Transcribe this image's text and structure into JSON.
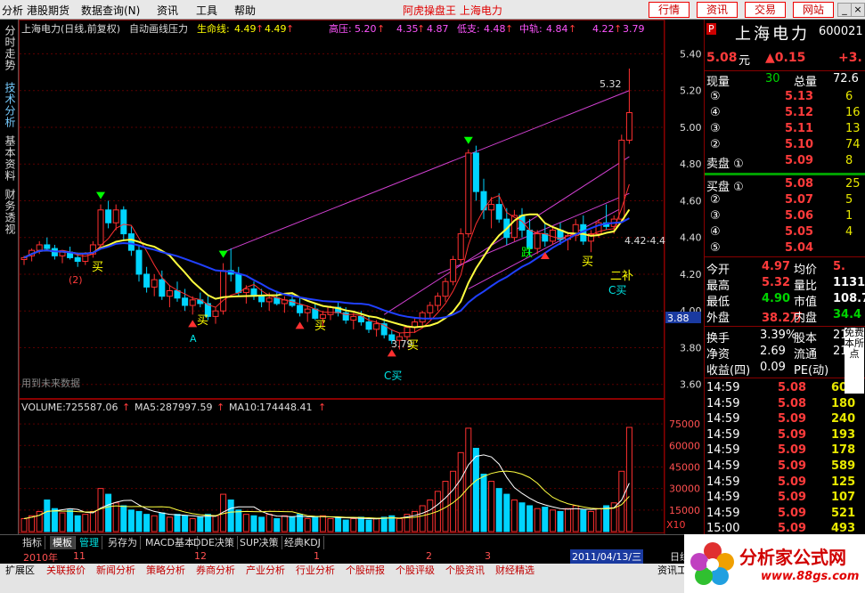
{
  "menubar": {
    "items": [
      "分析",
      "港股期货",
      "数据查询(N)",
      "资讯",
      "工具",
      "帮助"
    ],
    "title": "阿虎操盘王 上海电力",
    "buttons": [
      "行情",
      "资讯",
      "交易",
      "网站"
    ]
  },
  "sidetabs": [
    "分时走势",
    "技术分析",
    "基本资料",
    "财务透视"
  ],
  "chart": {
    "header": {
      "name": "上海电力(日线,前复权)",
      "indicator": "自动画线压力",
      "life_label": "生命线:",
      "life_value": "4.49",
      "life_value2": "4.49",
      "high_label": "高压:",
      "high_value": "5.20",
      "high_v2": "4.35",
      "high_v3": "4.87",
      "low_label": "低支:",
      "low_value": "4.48",
      "mid_label": "中轨:",
      "mid_value": "4.84",
      "mid_v2": "4.22",
      "mid_v3": "3.79"
    },
    "price_axis": [
      "5.40",
      "5.20",
      "5.00",
      "4.80",
      "4.60",
      "4.40",
      "4.20",
      "4.00",
      "3.80",
      "3.60"
    ],
    "price_marker": "3.88",
    "annotations": {
      "peak": "5.32",
      "low": "3.79",
      "right_level": "4.42-4.4",
      "buy": "买",
      "fall": "跌",
      "second_buy": "二补",
      "c_buy": "C买",
      "mark_2": "(2)",
      "mark_a": "A",
      "future_note": "用到未来数据"
    },
    "volume_header": {
      "volume_label": "VOLUME:",
      "volume_value": "725587.06",
      "ma5_label": "MA5:",
      "ma5_value": "287997.59",
      "ma10_label": "MA10:",
      "ma10_value": "174448.41"
    },
    "volume_axis": [
      "75000",
      "60000",
      "45000",
      "30000",
      "15000"
    ],
    "volume_unit": "X10",
    "date_axis": [
      "2010年",
      "11",
      "12",
      "1",
      "2",
      "3"
    ],
    "date_cursor": "2011/04/13/三",
    "period_label": "日线"
  },
  "chart_data": {
    "type": "candlestick",
    "title": "上海电力(日线,前复权)",
    "ylim": [
      3.55,
      5.48
    ],
    "candles": [
      [
        4.28,
        4.3,
        4.25,
        4.29
      ],
      [
        4.3,
        4.34,
        4.27,
        4.33
      ],
      [
        4.33,
        4.38,
        4.31,
        4.36
      ],
      [
        4.36,
        4.4,
        4.33,
        4.34
      ],
      [
        4.34,
        4.36,
        4.28,
        4.3
      ],
      [
        4.3,
        4.33,
        4.26,
        4.32
      ],
      [
        4.32,
        4.35,
        4.28,
        4.29
      ],
      [
        4.29,
        4.31,
        4.24,
        4.27
      ],
      [
        4.27,
        4.32,
        4.25,
        4.31
      ],
      [
        4.31,
        4.38,
        4.29,
        4.36
      ],
      [
        4.36,
        4.58,
        4.34,
        4.55
      ],
      [
        4.55,
        4.6,
        4.45,
        4.48
      ],
      [
        4.48,
        4.58,
        4.44,
        4.55
      ],
      [
        4.55,
        4.57,
        4.38,
        4.42
      ],
      [
        4.42,
        4.46,
        4.3,
        4.33
      ],
      [
        4.33,
        4.36,
        4.16,
        4.2
      ],
      [
        4.2,
        4.24,
        4.1,
        4.13
      ],
      [
        4.13,
        4.2,
        4.08,
        4.17
      ],
      [
        4.17,
        4.22,
        4.06,
        4.08
      ],
      [
        4.08,
        4.14,
        4.02,
        4.11
      ],
      [
        4.11,
        4.16,
        4.05,
        4.07
      ],
      [
        4.07,
        4.12,
        4.0,
        4.03
      ],
      [
        4.03,
        4.08,
        3.98,
        4.06
      ],
      [
        4.06,
        4.1,
        4.02,
        4.04
      ],
      [
        4.04,
        4.08,
        3.95,
        3.97
      ],
      [
        3.97,
        4.02,
        3.93,
        4.0
      ],
      [
        4.0,
        4.26,
        3.98,
        4.22
      ],
      [
        4.22,
        4.34,
        4.16,
        4.2
      ],
      [
        4.2,
        4.24,
        4.08,
        4.1
      ],
      [
        4.1,
        4.14,
        4.04,
        4.12
      ],
      [
        4.12,
        4.16,
        4.06,
        4.08
      ],
      [
        4.08,
        4.12,
        4.02,
        4.05
      ],
      [
        4.05,
        4.1,
        4.0,
        4.07
      ],
      [
        4.07,
        4.11,
        4.03,
        4.04
      ],
      [
        4.04,
        4.08,
        3.99,
        4.06
      ],
      [
        4.06,
        4.09,
        4.02,
        4.03
      ],
      [
        4.03,
        4.07,
        3.97,
        3.99
      ],
      [
        3.99,
        4.03,
        3.94,
        4.01
      ],
      [
        4.01,
        4.04,
        3.95,
        3.96
      ],
      [
        3.96,
        4.0,
        3.91,
        3.98
      ],
      [
        3.98,
        4.03,
        3.95,
        4.02
      ],
      [
        4.02,
        4.05,
        3.97,
        3.99
      ],
      [
        3.99,
        4.02,
        3.93,
        3.95
      ],
      [
        3.95,
        3.99,
        3.9,
        3.97
      ],
      [
        3.97,
        4.0,
        3.92,
        3.94
      ],
      [
        3.94,
        3.97,
        3.88,
        3.9
      ],
      [
        3.9,
        3.95,
        3.86,
        3.93
      ],
      [
        3.93,
        3.96,
        3.85,
        3.87
      ],
      [
        3.87,
        3.9,
        3.82,
        3.84
      ],
      [
        3.84,
        3.88,
        3.79,
        3.86
      ],
      [
        3.86,
        3.92,
        3.84,
        3.91
      ],
      [
        3.91,
        3.96,
        3.88,
        3.94
      ],
      [
        3.94,
        4.0,
        3.92,
        3.99
      ],
      [
        3.99,
        4.05,
        3.96,
        4.03
      ],
      [
        4.03,
        4.1,
        4.0,
        4.08
      ],
      [
        4.08,
        4.18,
        4.05,
        4.16
      ],
      [
        4.16,
        4.3,
        4.14,
        4.28
      ],
      [
        4.28,
        4.45,
        4.25,
        4.42
      ],
      [
        4.42,
        4.88,
        4.4,
        4.86
      ],
      [
        4.86,
        4.9,
        4.6,
        4.65
      ],
      [
        4.65,
        4.72,
        4.5,
        4.55
      ],
      [
        4.55,
        4.62,
        4.45,
        4.58
      ],
      [
        4.58,
        4.64,
        4.48,
        4.5
      ],
      [
        4.5,
        4.56,
        4.36,
        4.4
      ],
      [
        4.4,
        4.55,
        4.38,
        4.52
      ],
      [
        4.52,
        4.56,
        4.4,
        4.44
      ],
      [
        4.44,
        4.5,
        4.3,
        4.34
      ],
      [
        4.34,
        4.44,
        4.31,
        4.42
      ],
      [
        4.42,
        4.48,
        4.35,
        4.38
      ],
      [
        4.38,
        4.46,
        4.36,
        4.44
      ],
      [
        4.44,
        4.48,
        4.36,
        4.39
      ],
      [
        4.39,
        4.43,
        4.33,
        4.41
      ],
      [
        4.41,
        4.5,
        4.38,
        4.47
      ],
      [
        4.47,
        4.52,
        4.36,
        4.38
      ],
      [
        4.38,
        4.44,
        4.32,
        4.42
      ],
      [
        4.42,
        4.5,
        4.4,
        4.48
      ],
      [
        4.48,
        4.58,
        4.44,
        4.46
      ],
      [
        4.46,
        4.52,
        4.42,
        4.5
      ],
      [
        4.5,
        4.96,
        4.48,
        4.93
      ],
      [
        4.93,
        5.32,
        4.91,
        5.08
      ]
    ],
    "volume_ylim": [
      0,
      80000
    ],
    "volumes": [
      9000,
      11000,
      14000,
      22000,
      16000,
      13000,
      15000,
      11000,
      12000,
      14000,
      30000,
      26000,
      20000,
      18000,
      15000,
      14000,
      12000,
      11000,
      13000,
      10000,
      12000,
      11000,
      9000,
      10000,
      12000,
      11000,
      26000,
      22000,
      15000,
      12000,
      11000,
      10000,
      12000,
      9000,
      11000,
      10000,
      12000,
      9000,
      10000,
      11000,
      9000,
      10000,
      8000,
      9000,
      10000,
      8000,
      9000,
      10000,
      11000,
      9000,
      12000,
      14000,
      18000,
      22000,
      28000,
      35000,
      42000,
      55000,
      72000,
      58000,
      40000,
      35000,
      30000,
      26000,
      22000,
      20000,
      18000,
      16000,
      17000,
      15000,
      14000,
      16000,
      18000,
      15000,
      14000,
      16000,
      18000,
      20000,
      42000,
      72558
    ]
  },
  "panel": {
    "stock_name": "上海电力",
    "stock_code": "600021",
    "price": "5.08",
    "price_unit": "元",
    "change": "▲0.15",
    "change_pct": "+3.",
    "now_vol_label": "现量",
    "now_vol": "30",
    "total_vol_label": "总量",
    "total_vol": "72.6",
    "sell_orders": [
      {
        "lvl": "⑤",
        "price": "5.13",
        "vol": "6"
      },
      {
        "lvl": "④",
        "price": "5.12",
        "vol": "16"
      },
      {
        "lvl": "③",
        "price": "5.11",
        "vol": "13"
      },
      {
        "lvl": "②",
        "price": "5.10",
        "vol": "74"
      },
      {
        "lvl": "卖盘 ①",
        "price": "5.09",
        "vol": "8"
      }
    ],
    "buy_orders": [
      {
        "lvl": "买盘 ①",
        "price": "5.08",
        "vol": "25"
      },
      {
        "lvl": "②",
        "price": "5.07",
        "vol": "5"
      },
      {
        "lvl": "③",
        "price": "5.06",
        "vol": "1"
      },
      {
        "lvl": "④",
        "price": "5.05",
        "vol": "4"
      },
      {
        "lvl": "⑤",
        "price": "5.04",
        "vol": ""
      }
    ],
    "stats": [
      {
        "l1": "今开",
        "v1": "4.97",
        "c1": "red",
        "l2": "均价",
        "v2": "5.",
        "c2": "red"
      },
      {
        "l1": "最高",
        "v1": "5.32",
        "c1": "red",
        "l2": "量比",
        "v2": "1131.",
        "c2": "white"
      },
      {
        "l1": "最低",
        "v1": "4.90",
        "c1": "green",
        "l2": "市值",
        "v2": "108.7",
        "c2": "white"
      },
      {
        "l1": "外盘",
        "v1": "38.2万",
        "c1": "red",
        "l2": "内盘",
        "v2": "34.4",
        "c2": "green"
      }
    ],
    "stats2": [
      {
        "l1": "换手",
        "v1": "3.39%",
        "l2": "股本",
        "v2": "21"
      },
      {
        "l1": "净资",
        "v1": "2.69",
        "l2": "流通",
        "v2": "21"
      },
      {
        "l1": "收益(四)",
        "v1": "0.09",
        "l2": "PE(动)",
        "v2": ""
      }
    ],
    "ticks": [
      {
        "t": "14:59",
        "p": "5.08",
        "v": "60"
      },
      {
        "t": "14:59",
        "p": "5.08",
        "v": "180"
      },
      {
        "t": "14:59",
        "p": "5.09",
        "v": "240"
      },
      {
        "t": "14:59",
        "p": "5.09",
        "v": "193"
      },
      {
        "t": "14:59",
        "p": "5.09",
        "v": "178"
      },
      {
        "t": "14:59",
        "p": "5.09",
        "v": "589"
      },
      {
        "t": "14:59",
        "p": "5.09",
        "v": "125"
      },
      {
        "t": "14:59",
        "p": "5.09",
        "v": "107"
      },
      {
        "t": "14:59",
        "p": "5.09",
        "v": "521"
      },
      {
        "t": "15:00",
        "p": "5.09",
        "v": "493"
      }
    ],
    "side_popup": "免费本所点"
  },
  "tabs1": [
    "指标",
    "模板",
    "管理",
    "另存为",
    "MACD基本",
    "DDE决策",
    "SUP决策",
    "经典KDJ"
  ],
  "tabs2": [
    "扩展区",
    "关联报价",
    "新闻分析",
    "策略分析",
    "券商分析",
    "产业分析",
    "行业分析",
    "个股研报",
    "个股评级",
    "个股资讯",
    "财经精选",
    "资讯工"
  ],
  "watermark": {
    "name": "分析家公式网",
    "url": "www.88gs.com"
  }
}
